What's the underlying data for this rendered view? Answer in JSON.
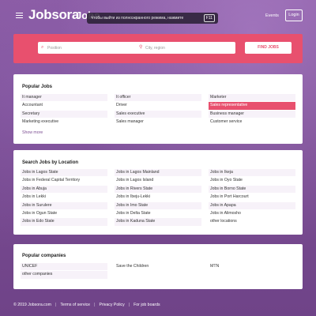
{
  "header": {
    "logo": "Jobsora",
    "logo_tail": "Jobs",
    "fullscreen_notice": "Чтобы выйти из полноэкранного режима, нажмите",
    "fullscreen_key": "F11",
    "events": "Events",
    "login": "Login"
  },
  "search": {
    "position_placeholder": "Position",
    "city_placeholder": "City, region",
    "find_button": "FIND JOBS"
  },
  "popular_jobs": {
    "title": "Popular Jobs",
    "rows": [
      [
        "It manager",
        "It officer",
        "Marketer"
      ],
      [
        "Accountant",
        "Driver",
        "Sales representative"
      ],
      [
        "Secretary",
        "Sales executive",
        "Business manager"
      ],
      [
        "Marketing executive",
        "Sales manager",
        "Customer service"
      ]
    ],
    "show_more": "Show more"
  },
  "jobs_by_location": {
    "title": "Search Jobs by Location",
    "rows": [
      [
        "Jobs in Lagos State",
        "Jobs in Lagos Mainland",
        "Jobs in Ikeja"
      ],
      [
        "Jobs in Federal Capital Territory",
        "Jobs in Lagos Island",
        "Jobs in Oyo State"
      ],
      [
        "Jobs in Abuja",
        "Jobs in Rivers State",
        "Jobs in Borno State"
      ],
      [
        "Jobs in Lekki",
        "Jobs in Ibeju-Lekki",
        "Jobs in Port Harcourt"
      ],
      [
        "Jobs in Surulere",
        "Jobs in Imo State",
        "Jobs in Apapa"
      ],
      [
        "Jobs in Ogun State",
        "Jobs in Delta State",
        "Jobs in Alimosho"
      ],
      [
        "Jobs in Edo State",
        "Jobs in Kaduna State",
        "other locations"
      ]
    ]
  },
  "popular_companies": {
    "title": "Popular companies",
    "rows": [
      [
        "UNICEF",
        "Save the Children",
        "MTN"
      ],
      [
        "other companies",
        "",
        ""
      ]
    ]
  },
  "footer": {
    "copyright": "© 2019 Jobsora.com",
    "terms": "Terms of service",
    "privacy": "Privacy Policy",
    "job_boards": "For job boards"
  },
  "colors": {
    "accent": "#e8506e",
    "background": "#7d4f93"
  }
}
